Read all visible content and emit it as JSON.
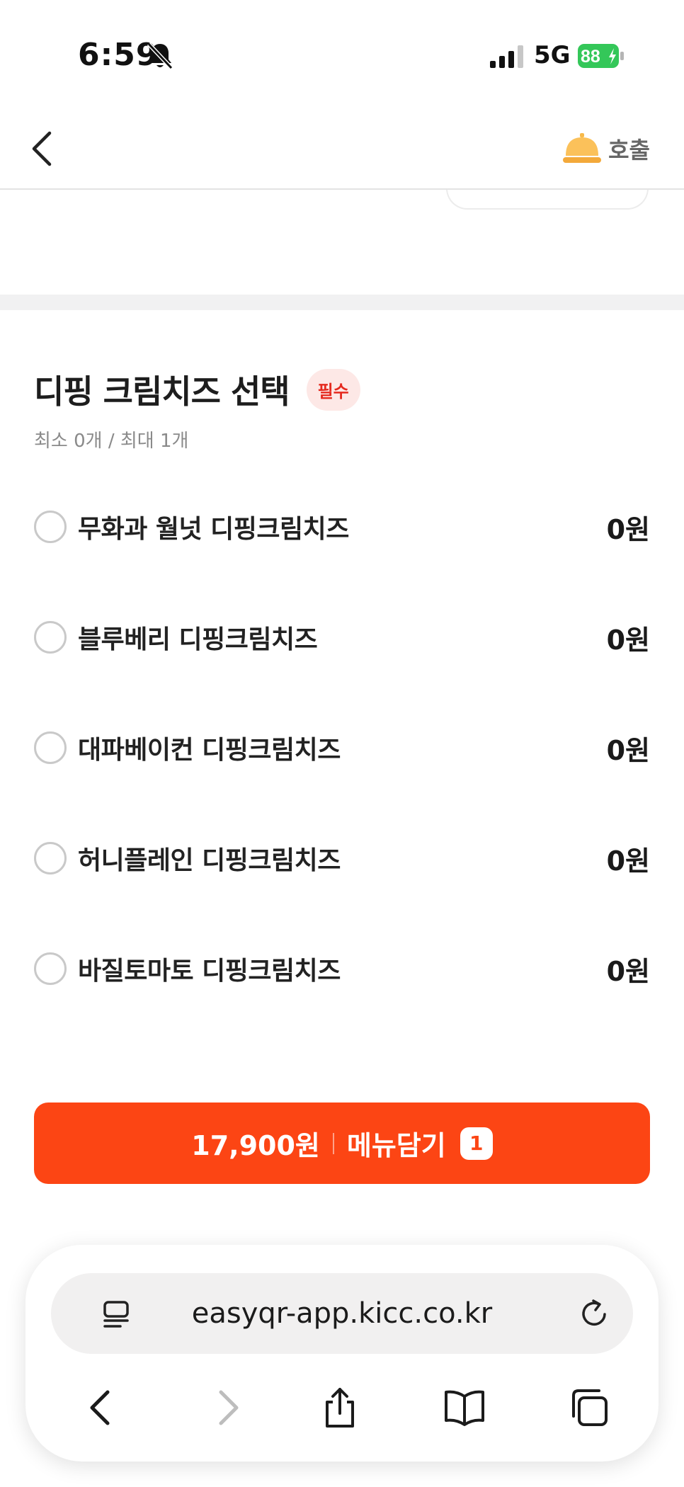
{
  "status_bar": {
    "time": "6:59",
    "network": "5G",
    "battery": "88"
  },
  "header": {
    "call_label": "호출"
  },
  "section": {
    "title": "디핑 크림치즈 선택",
    "required_badge": "필수",
    "subtitle": "최소 0개 / 최대 1개"
  },
  "options": [
    {
      "name": "무화과 월넛 디핑크림치즈",
      "price": "0원"
    },
    {
      "name": "블루베리 디핑크림치즈",
      "price": "0원"
    },
    {
      "name": "대파베이컨 디핑크림치즈",
      "price": "0원"
    },
    {
      "name": "허니플레인 디핑크림치즈",
      "price": "0원"
    },
    {
      "name": "바질토마토 디핑크림치즈",
      "price": "0원"
    }
  ],
  "cart_button": {
    "price": "17,900원",
    "label": "메뉴담기",
    "count": "1"
  },
  "browser": {
    "url": "easyqr-app.kicc.co.kr"
  },
  "colors": {
    "accent": "#fc4514",
    "badge_bg": "#fde8e6",
    "badge_text": "#e52a1f",
    "battery": "#34c759"
  }
}
